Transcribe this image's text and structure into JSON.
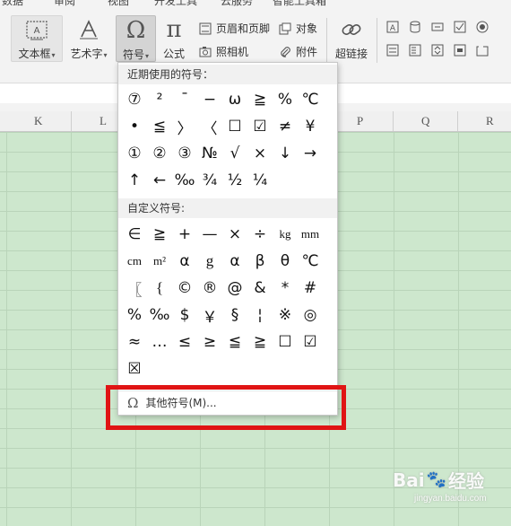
{
  "menu_tabs": [
    "数据",
    "审阅",
    "视图",
    "开发工具",
    "云服务",
    "智能工具箱"
  ],
  "ribbon": {
    "textbox_label": "文本框",
    "wordart_label": "艺术字",
    "symbol_label": "符号",
    "formula_label": "公式",
    "header_footer_label": "页眉和页脚",
    "object_label": "对象",
    "camera_label": "照相机",
    "attachment_label": "附件",
    "hyperlink_label": "超链接"
  },
  "columns": [
    "K",
    "L",
    "P",
    "Q",
    "R"
  ],
  "dropdown": {
    "recent_title": "近期使用的符号：",
    "recent_symbols": [
      "⑦",
      "²",
      "¯",
      "−",
      "ω",
      "≧",
      "%",
      "℃",
      "•",
      "≦",
      "〉",
      "〈",
      "☐",
      "☑",
      "≠",
      "¥",
      "①",
      "②",
      "③",
      "№",
      "√",
      "×",
      "↓",
      "→",
      "↑",
      "←",
      "‰",
      "¾",
      "½",
      "¼"
    ],
    "custom_title": "自定义符号:",
    "custom_symbols": [
      "∈",
      "≧",
      "+",
      "—",
      "×",
      "÷",
      "kg",
      "mm",
      "cm",
      "m²",
      "α",
      "g",
      "α",
      "β",
      "θ",
      "℃",
      "〖",
      "{",
      "©",
      "®",
      "@",
      "&",
      "*",
      "#",
      "%",
      "‰",
      "$",
      "￥",
      "§",
      "¦",
      "※",
      "◎",
      "≈",
      "…",
      "≤",
      "≥",
      "≦",
      "≧",
      "☐",
      "☑",
      "☒"
    ],
    "more_label": "其他符号(M)..."
  },
  "watermark": {
    "brand": "Bai",
    "brand_suffix": "经验",
    "url": "jingyan.baidu.com"
  }
}
